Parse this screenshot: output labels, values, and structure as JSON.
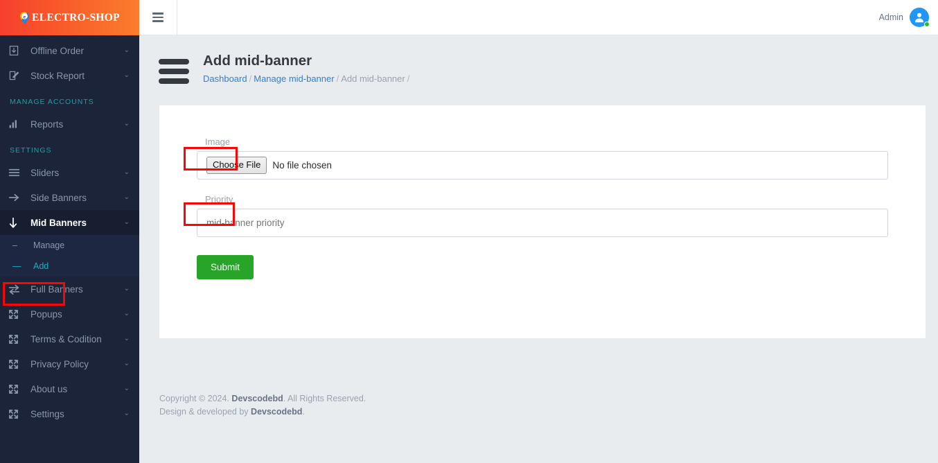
{
  "brand": {
    "name": "ELECTRO-SHOP",
    "logo_icon": "location-pin-e-icon",
    "gradient_from": "#f6402c",
    "gradient_to": "#fb7d2c"
  },
  "topbar": {
    "menu_toggle_icon": "hamburger-icon",
    "admin_label": "Admin",
    "avatar_icon": "user-avatar-icon",
    "status_color": "#27c024"
  },
  "sidebar": {
    "items": [
      {
        "label": "Offline Order",
        "icon": "inbox-download-icon",
        "chevron": "⌄",
        "active": false
      },
      {
        "label": "Stock Report",
        "icon": "edit-square-icon",
        "chevron": "⌄",
        "active": false
      }
    ],
    "heading_accounts": "MANAGE ACCOUNTS",
    "accounts_items": [
      {
        "label": "Reports",
        "icon": "bar-chart-icon",
        "chevron": "⌄",
        "active": false
      }
    ],
    "heading_settings": "SETTINGS",
    "settings_items": [
      {
        "label": "Sliders",
        "icon": "menu-lines-icon",
        "chevron": "⌄",
        "active": false
      },
      {
        "label": "Side Banners",
        "icon": "arrow-right-icon",
        "chevron": "⌄",
        "active": false
      },
      {
        "label": "Mid Banners",
        "icon": "arrow-down-icon",
        "chevron": "⌄",
        "active": true
      }
    ],
    "mid_banners_submenu": [
      {
        "label": "Manage",
        "marker": "–",
        "current": false
      },
      {
        "label": "Add",
        "marker": "—",
        "current": true
      }
    ],
    "settings_items_rest": [
      {
        "label": "Full Banners",
        "icon": "swap-arrows-icon",
        "chevron": "⌄",
        "active": false
      },
      {
        "label": "Popups",
        "icon": "expand-icon",
        "chevron": "⌄",
        "active": false
      },
      {
        "label": "Terms & Codition",
        "icon": "expand-icon",
        "chevron": "⌄",
        "active": false
      },
      {
        "label": "Privacy Policy",
        "icon": "expand-icon",
        "chevron": "⌄",
        "active": false
      },
      {
        "label": "About us",
        "icon": "expand-icon",
        "chevron": "⌄",
        "active": false
      },
      {
        "label": "Settings",
        "icon": "expand-icon",
        "chevron": "⌄",
        "active": false
      }
    ]
  },
  "page": {
    "title": "Add mid-banner",
    "breadcrumb": {
      "dashboard": "Dashboard",
      "manage": "Manage mid-banner",
      "current": "Add mid-banner",
      "separator": "/",
      "trailing": "/"
    }
  },
  "form": {
    "image_label": "Image",
    "file_button": "Choose File",
    "file_status": "No file chosen",
    "priority_label": "Priority",
    "priority_placeholder": "mid-banner priority",
    "priority_value": "",
    "submit_label": "Submit",
    "submit_color": "#28a428"
  },
  "footer": {
    "copyright_prefix": "Copyright © 2024.",
    "copyright_brand": "Devscodebd",
    "copyright_suffix": ". All Rights Reserved.",
    "design_prefix": "Design & developed by",
    "design_brand": "Devscodebd",
    "design_suffix": "."
  },
  "annotations": {
    "highlight_color": "#fb0606",
    "boxes": [
      "image-label",
      "priority-label",
      "sidebar-add-link"
    ]
  }
}
